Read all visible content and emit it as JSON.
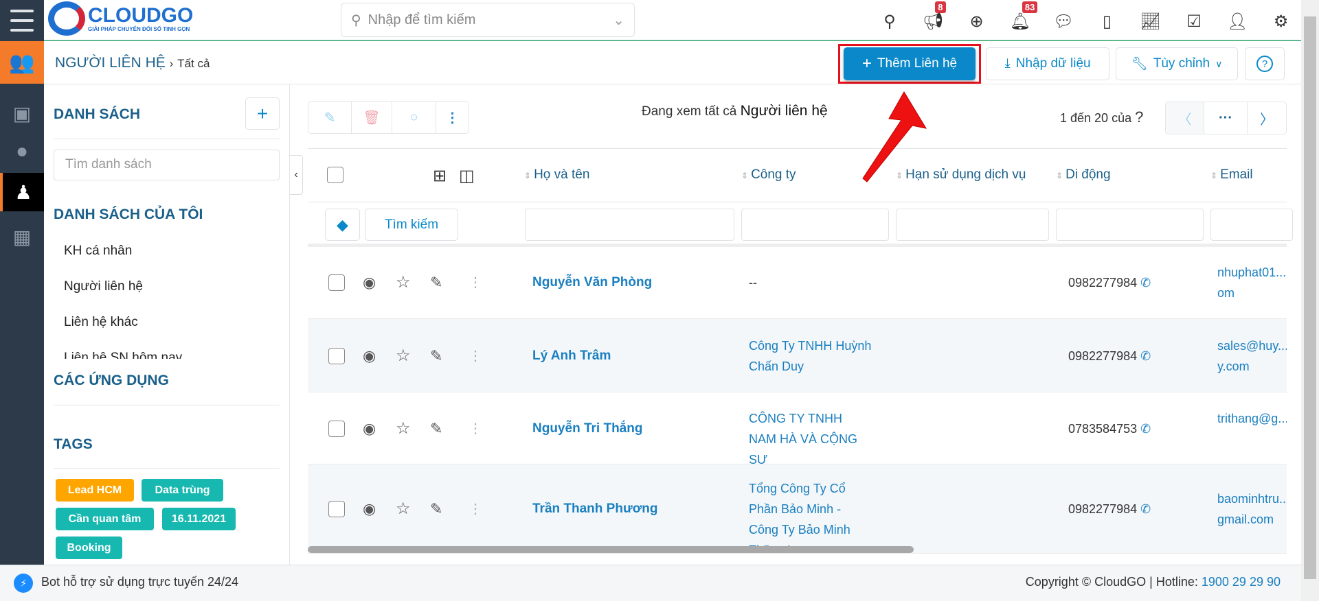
{
  "brand": {
    "name": "CLOUDGO",
    "tagline": "GIẢI PHÁP CHUYỂN ĐỔI SỐ TINH GỌN"
  },
  "search": {
    "placeholder": "Nhập để tìm kiếm"
  },
  "topicons": [
    {
      "icon": "map-marker-help-icon"
    },
    {
      "icon": "megaphone-icon",
      "badge": "8"
    },
    {
      "icon": "plus-circle-icon"
    },
    {
      "icon": "bell-icon",
      "badge": "83"
    },
    {
      "icon": "chat-icon"
    },
    {
      "icon": "calendar-icon"
    },
    {
      "icon": "chart-icon"
    },
    {
      "icon": "checkbox-icon"
    },
    {
      "icon": "user-icon"
    },
    {
      "icon": "gear-icon"
    }
  ],
  "breadcrumb": {
    "module": "NGƯỜI LIÊN HỆ",
    "current": "Tất cả"
  },
  "actions": {
    "add": "Thêm Liên hệ",
    "import": "Nhập dữ liệu",
    "customize": "Tùy chỉnh"
  },
  "sidebar": {
    "lists_title": "DANH SÁCH",
    "list_search_placeholder": "Tìm danh sách",
    "my_lists_title": "DANH SÁCH CỦA TÔI",
    "my_lists": [
      "KH cá nhân",
      "Người liên hệ",
      "Liên hệ khác",
      "Liên hệ SN hôm nay"
    ],
    "apps_title": "CÁC ỨNG DỤNG",
    "tags_title": "TAGS",
    "tags": [
      {
        "label": "Lead HCM",
        "color": "#ffa500"
      },
      {
        "label": "Data trùng",
        "color": "#16b8b0"
      },
      {
        "label": "Cần quan tâm",
        "color": "#16b8b0"
      },
      {
        "label": "16.11.2021",
        "color": "#16b8b0"
      },
      {
        "label": "Booking",
        "color": "#16b8b0"
      }
    ]
  },
  "view": {
    "prefix": "Đang xem tất cả",
    "module": "Người liên hệ"
  },
  "pager": {
    "text": "1 đến 20 của",
    "total": "?",
    "more": "···"
  },
  "table": {
    "columns": [
      "Họ và tên",
      "Công ty",
      "Hạn sử dụng dịch vụ",
      "Di động",
      "Email"
    ],
    "search_button": "Tìm kiếm",
    "rows": [
      {
        "name": "Nguyễn Văn Phòng",
        "company": "--",
        "expiry": "",
        "phone": "0982277984",
        "email": "nhuphat01...om"
      },
      {
        "name": "Lý Anh Trâm",
        "company": "Công Ty TNHH Huỳnh Chấn Duy",
        "expiry": "",
        "phone": "0982277984",
        "email": "sales@huy...y.com"
      },
      {
        "name": "Nguyễn Tri Thắng",
        "company": "CÔNG TY TNHH NAM HÀ VÀ CỘNG SỰ",
        "expiry": "",
        "phone": "0783584753",
        "email": "trithang@g..."
      },
      {
        "name": "Trần Thanh Phương",
        "company": "Tổng Công Ty Cổ Phần Bảo Minh - Công Ty Bảo Minh Thăng Long",
        "expiry": "",
        "phone": "0982277984",
        "email": "baominhtru...gmail.com"
      }
    ]
  },
  "footer": {
    "bot": "Bot hỗ trợ sử dụng trực tuyến 24/24",
    "copyright": "Copyright © CloudGO",
    "hotline_label": "Hotline:",
    "hotline": "1900 29 29 90"
  },
  "colors": {
    "accent": "#0a88c9",
    "rail": "#2c3a4a",
    "active_module": "#f47b2a",
    "highlight": "#e8101a"
  }
}
